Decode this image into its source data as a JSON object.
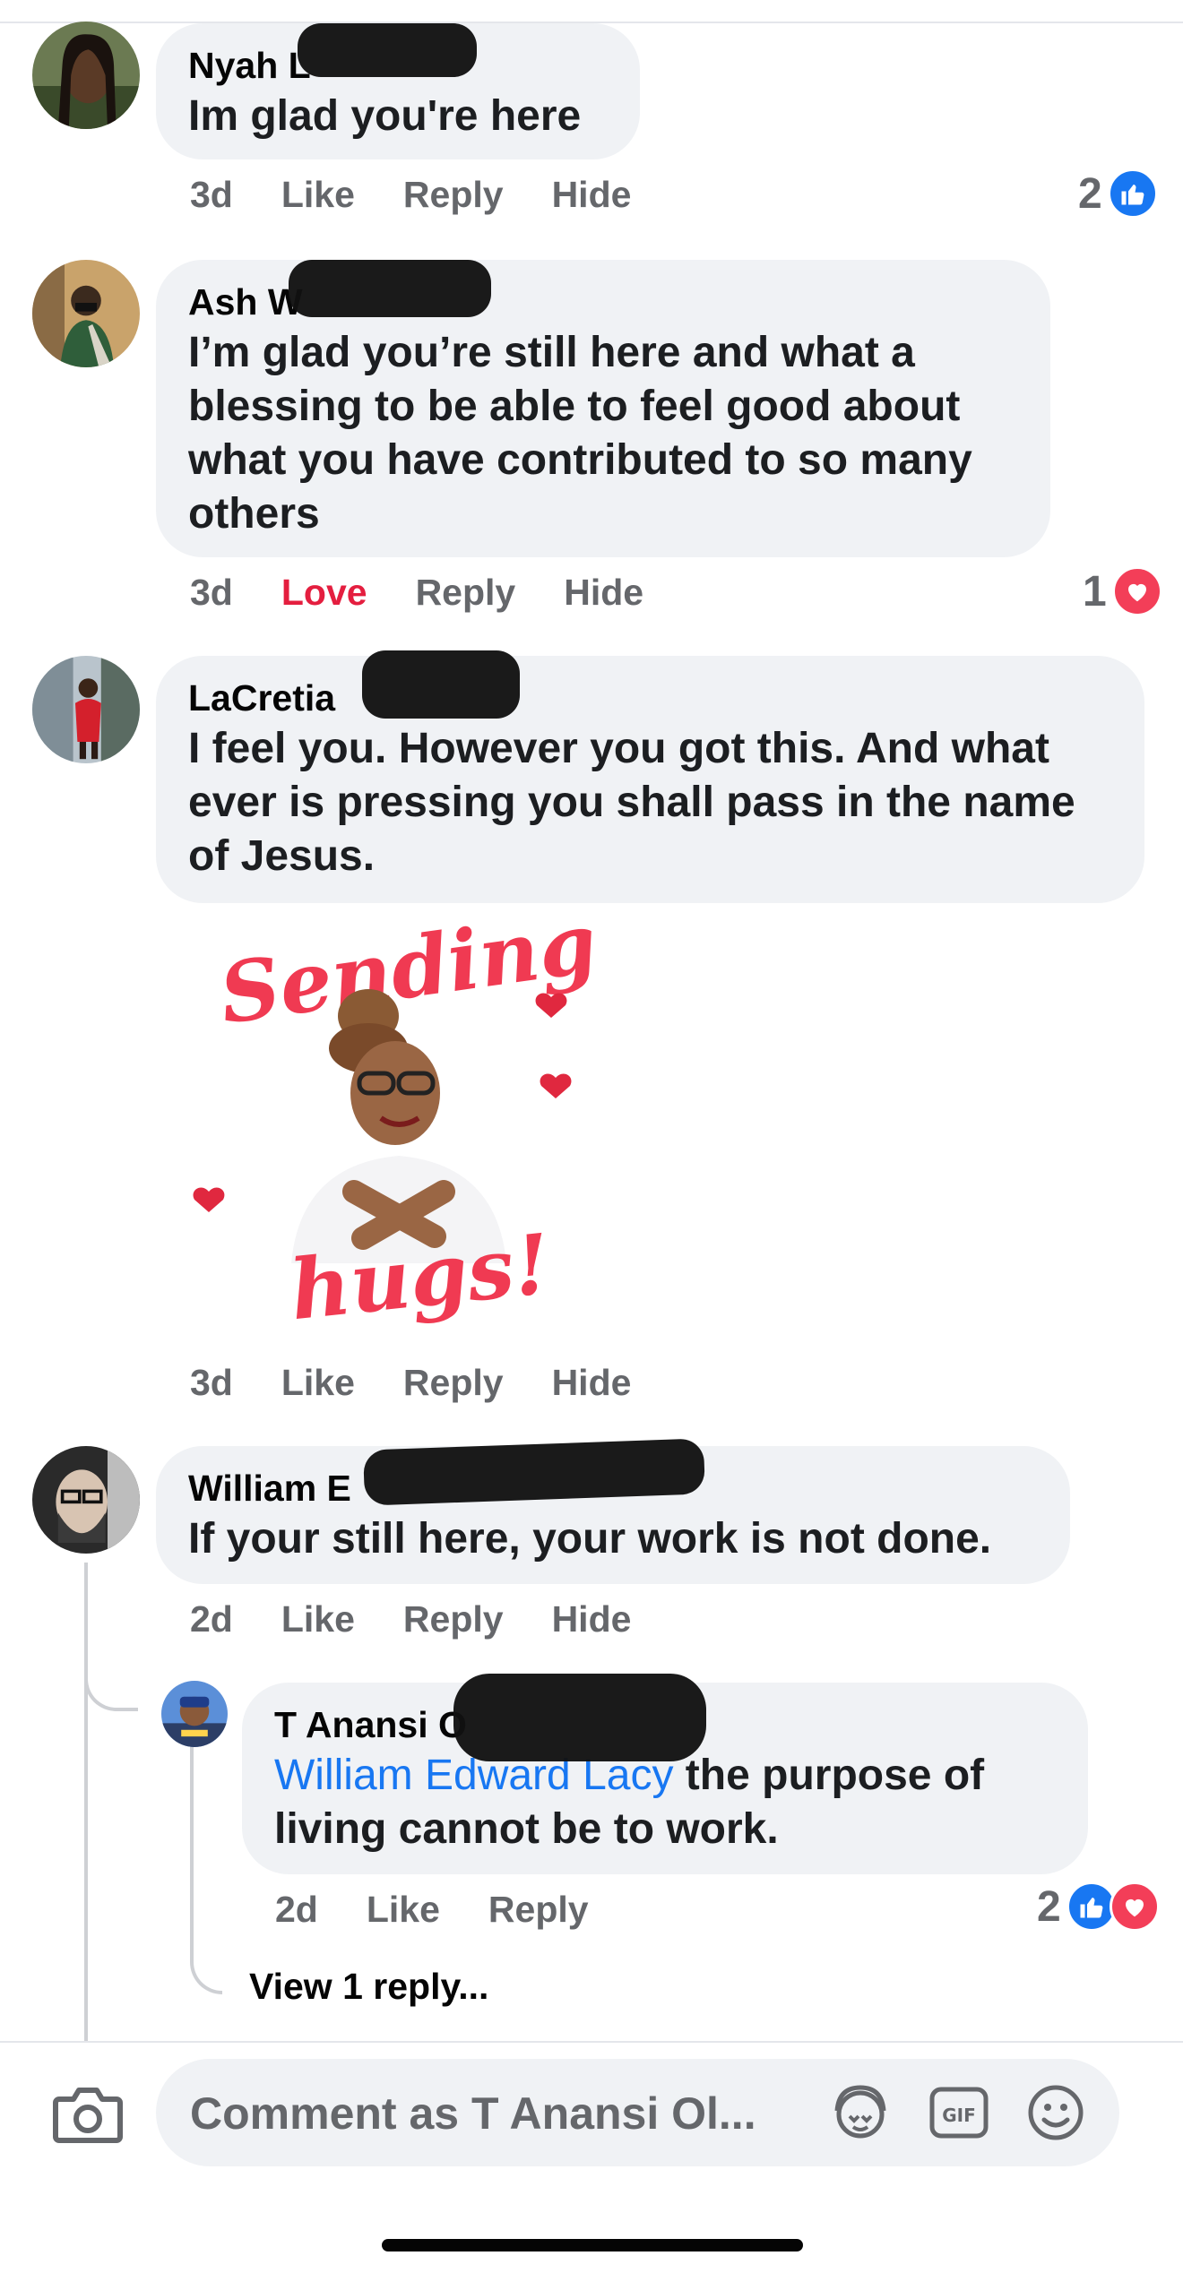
{
  "comments": [
    {
      "author": "Nyah L",
      "text": "Im glad you're here",
      "time": "3d",
      "actions": [
        "Like",
        "Reply",
        "Hide"
      ],
      "reaction_count": "2",
      "reaction_icons": [
        "like-icon"
      ]
    },
    {
      "author": "Ash W",
      "text": "I’m glad you’re still here and what a blessing to be able to feel good about what you have contributed to so many others",
      "time": "3d",
      "actions": [
        "Love",
        "Reply",
        "Hide"
      ],
      "reaction_count": "1",
      "reaction_icons": [
        "love-icon"
      ]
    },
    {
      "author": "LaCretia",
      "text": "I feel you. However you got this.  And what ever is pressing you shall pass in the name of Jesus.",
      "time": "3d",
      "actions": [
        "Like",
        "Reply",
        "Hide"
      ],
      "sticker": {
        "top_text": "Sending",
        "bottom_text": "hugs!"
      }
    },
    {
      "author": "William E",
      "text": "If your still here, your work is not done.",
      "time": "2d",
      "actions": [
        "Like",
        "Reply",
        "Hide"
      ]
    }
  ],
  "reply": {
    "author": "T Anansi O",
    "mention": "William Edward Lacy",
    "text": " the purpose of living cannot be to work.",
    "time": "2d",
    "actions": [
      "Like",
      "Reply"
    ],
    "reaction_count": "2",
    "reaction_icons": [
      "like-icon",
      "love-icon"
    ]
  },
  "view_replies": "View 1 reply...",
  "composer": {
    "placeholder": "Comment as T Anansi Ol...",
    "gif_label": "GIF"
  },
  "colors": {
    "bubble": "#f0f2f5",
    "action_text": "#65676b",
    "love": "#e41e3f",
    "like_blue": "#1877f2",
    "mention_blue": "#1877f2"
  }
}
